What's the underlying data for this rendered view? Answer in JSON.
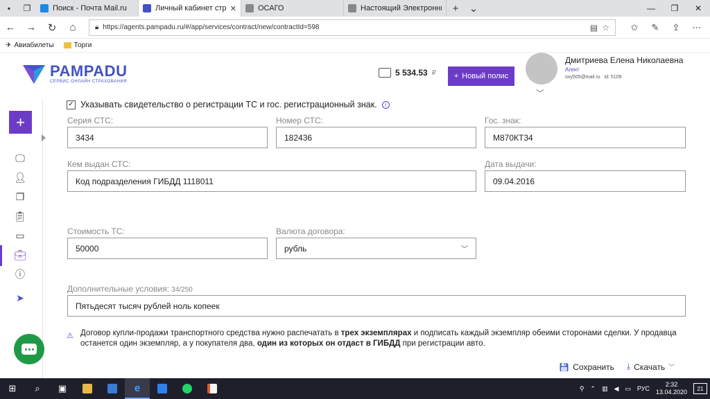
{
  "browser": {
    "tabs": [
      {
        "title": "Поиск - Почта Mail.ru",
        "fav_color": "#1e88e5",
        "active": false
      },
      {
        "title": "Личный кабинет страх",
        "fav_color": "#4253c5",
        "active": true
      },
      {
        "title": "ОСАГО",
        "fav_color": "#888888",
        "active": false
      },
      {
        "title": "Настоящий Электронный П",
        "fav_color": "#888888",
        "active": false
      }
    ],
    "url": "https://agents.pampadu.ru/#/app/services/contract/new/contractId=598",
    "bookmarks": [
      {
        "label": "Авиабилеты",
        "icon": "plane-icon"
      },
      {
        "label": "Торги",
        "icon": "folder-icon"
      }
    ]
  },
  "header": {
    "logo_name": "PAMPADU",
    "logo_sub": "СЕРВИС ОНЛАЙН СТРАХОВАНИЯ",
    "balance": "5 534.53",
    "currency": "₽",
    "new_policy": "Новый полис",
    "user_name": "Дмитриева Елена Николаевна",
    "user_role": "Агент",
    "user_email": "oxy505@mail.ru",
    "user_id": "id: 5109"
  },
  "form": {
    "checkbox_label": "Указывать свидетельство о регистрации ТС и гос. регистрационный знак.",
    "checkbox_checked": true,
    "sts_series_label": "Серия СТС:",
    "sts_series_value": "3434",
    "sts_number_label": "Номер СТС:",
    "sts_number_value": "182436",
    "plate_label": "Гос. знак:",
    "plate_value": "М870КТ34",
    "issued_by_label": "Кем выдан СТС:",
    "issued_by_value": "Код подразделения ГИБДД 1118011",
    "issue_date_label": "Дата выдачи:",
    "issue_date_value": "09.04.2016",
    "price_label": "Стоимость ТС:",
    "price_value": "50000",
    "currency_label": "Валюта договора:",
    "currency_value": "рубль",
    "extra_label": "Дополнительные условия:",
    "extra_counter": "34/250",
    "extra_value": "Пятьдесят тысяч рублей ноль копеек",
    "notice_a": "Договор купли-продажи транспортного средства нужно распечатать в ",
    "notice_b": "трех экземплярах",
    "notice_c": " и подписать каждый экземпляр обеими сторонами сделки. У продавца останется один экземпляр, а у покупателя два, ",
    "notice_d": "один из которых он отдаст в ГИБДД",
    "notice_e": " при регистрации авто.",
    "save": "Сохранить",
    "download": "Скачать"
  },
  "taskbar": {
    "lang": "РУС",
    "time": "2:32",
    "date": "13.04.2020",
    "notif_count": "21"
  }
}
